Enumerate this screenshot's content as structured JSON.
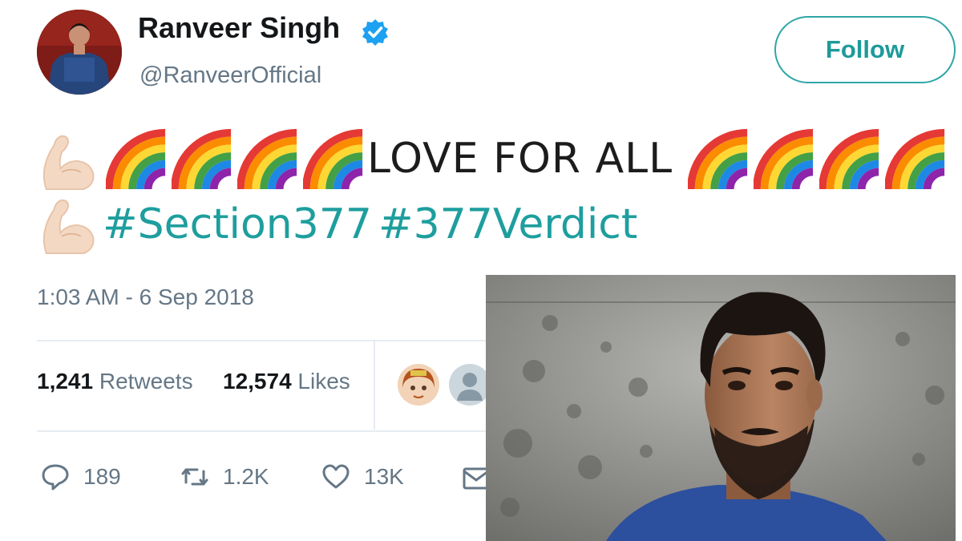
{
  "user": {
    "display_name": "Ranveer Singh",
    "handle": "@RanveerOfficial",
    "verified": true
  },
  "follow_label": "Follow",
  "tweet": {
    "text": "LOVE FOR ALL",
    "hashtags": [
      "#Section377",
      "#377Verdict"
    ],
    "emoji_icons": [
      "flexed-biceps-icon",
      "rainbow-icon"
    ],
    "timestamp": "1:03 AM - 6 Sep 2018"
  },
  "stats": {
    "retweets_count": "1,241",
    "retweets_label": "Retweets",
    "likes_count": "12,574",
    "likes_label": "Likes"
  },
  "actions": {
    "reply_count": "189",
    "retweet_count": "1.2K",
    "like_count": "13K"
  },
  "colors": {
    "accent": "#1e9e9e",
    "verified": "#1da1f2",
    "muted": "#657786"
  }
}
